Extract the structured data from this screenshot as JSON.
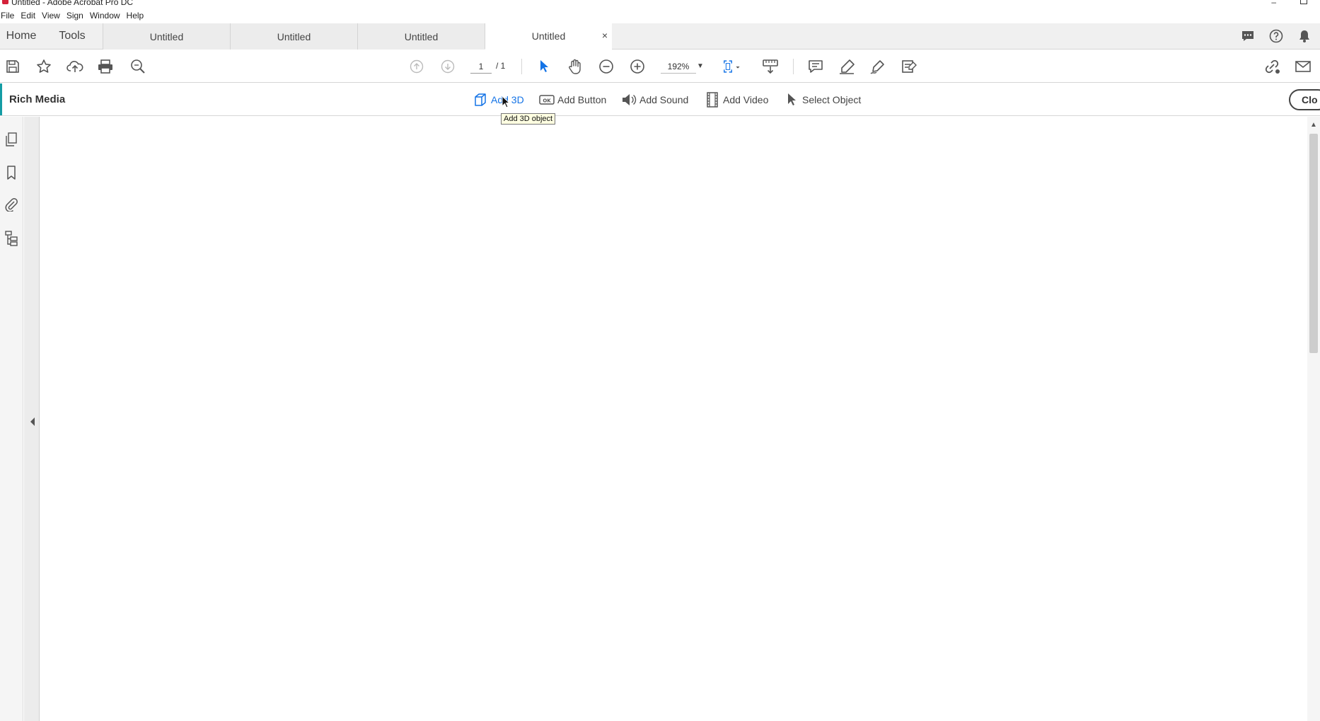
{
  "window": {
    "title": "Untitled - Adobe Acrobat Pro DC"
  },
  "menubar": {
    "items": [
      "File",
      "Edit",
      "View",
      "Sign",
      "Window",
      "Help"
    ]
  },
  "tabs": {
    "home": "Home",
    "tools": "Tools",
    "documents": [
      {
        "label": "Untitled",
        "active": false
      },
      {
        "label": "Untitled",
        "active": false
      },
      {
        "label": "Untitled",
        "active": false
      },
      {
        "label": "Untitled",
        "active": true
      }
    ],
    "close_glyph": "×"
  },
  "toolbar": {
    "icons": [
      "save-icon",
      "star-icon",
      "upload-icon",
      "print-icon",
      "search-zoom-icon",
      "prev-page-icon",
      "next-page-icon",
      "select-cursor-icon",
      "hand-icon",
      "zoom-out-icon",
      "zoom-in-icon",
      "fit-page-icon",
      "scroll-mode-icon",
      "comment-icon",
      "highlight-icon",
      "sign-icon",
      "redact-icon",
      "share-link-icon",
      "email-icon"
    ],
    "page_current": "1",
    "page_total": "/ 1",
    "zoom": "192%"
  },
  "rich_media": {
    "title": "Rich Media",
    "tools": [
      {
        "label": "Add 3D",
        "icon": "cube-icon",
        "active": true
      },
      {
        "label": "Add Button",
        "icon": "ok-button-icon",
        "active": false
      },
      {
        "label": "Add Sound",
        "icon": "speaker-icon",
        "active": false
      },
      {
        "label": "Add Video",
        "icon": "film-icon",
        "active": false
      },
      {
        "label": "Select Object",
        "icon": "arrow-cursor-icon",
        "active": false
      }
    ],
    "close_label": "Clo"
  },
  "tooltip": {
    "text": "Add 3D object"
  },
  "colors": {
    "accent": "#1473e6",
    "rich_media_accent": "#149ca4"
  }
}
